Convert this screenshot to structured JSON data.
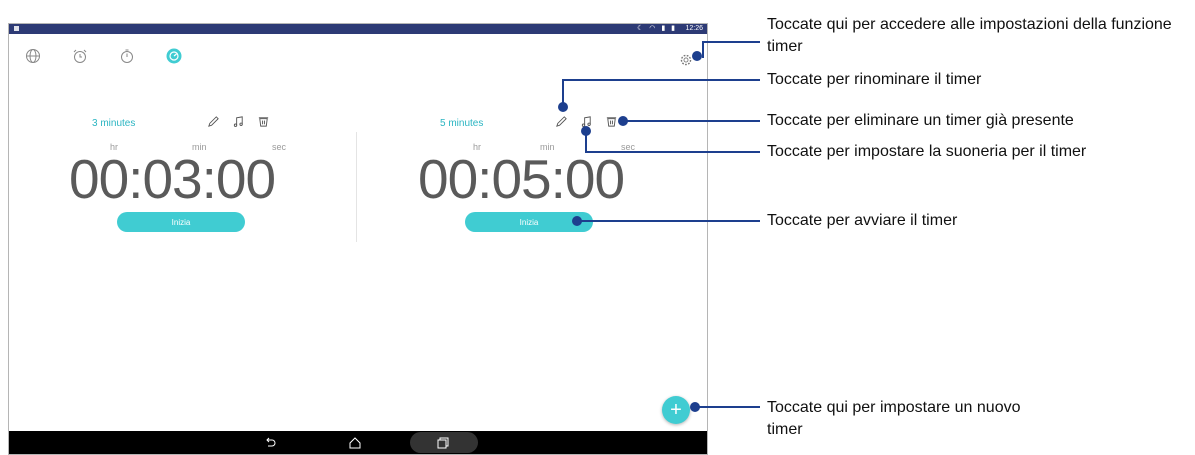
{
  "status_bar": {
    "time": "12:26"
  },
  "tabs": [
    {
      "name": "world-clock"
    },
    {
      "name": "alarm"
    },
    {
      "name": "stopwatch"
    },
    {
      "name": "timer",
      "active": true
    }
  ],
  "timers": [
    {
      "name": "3 minutes",
      "hr_label": "hr",
      "min_label": "min",
      "sec_label": "sec",
      "time": "00:03:00",
      "start_label": "Inizia"
    },
    {
      "name": "5 minutes",
      "hr_label": "hr",
      "min_label": "min",
      "sec_label": "sec",
      "time": "00:05:00",
      "start_label": "Inizia"
    }
  ],
  "fab_label": "+",
  "colors": {
    "accent": "#40ccd2",
    "status_bar": "#2d3a75",
    "callout_line": "#1d3f8e"
  },
  "callouts": {
    "settings": "Toccate qui per accedere alle impostazioni della funzione timer",
    "rename": "Toccate per rinominare il timer",
    "delete": "Toccate per eliminare un timer già presente",
    "ringtone": "Toccate per impostare la suoneria per il timer",
    "start": "Toccate per avviare il timer",
    "add": "Toccate qui per impostare un nuovo timer"
  }
}
